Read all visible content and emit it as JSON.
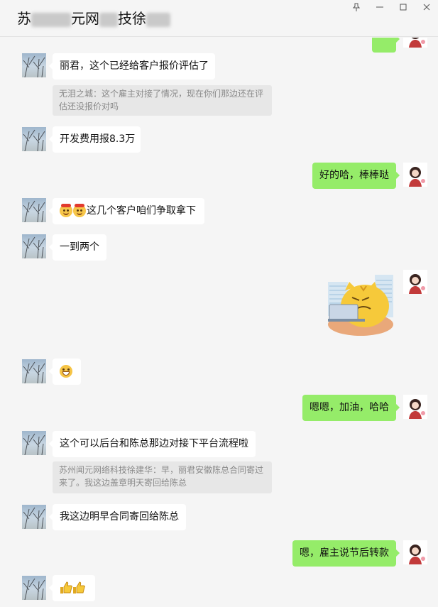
{
  "window": {
    "title_visible_parts": [
      "苏",
      "元网",
      "技徐"
    ],
    "controls": [
      "pin-icon",
      "minimize-icon",
      "maximize-icon",
      "close-icon"
    ]
  },
  "colors": {
    "sent_bubble": "#95ec69",
    "received_bubble": "#ffffff",
    "quote_bg": "#e7e7e7",
    "chat_bg": "#f5f5f5"
  },
  "messages": [
    {
      "side": "left",
      "text": "丽君，这个已经给客户报价评估了"
    },
    {
      "side": "quote",
      "text": "无泪之城：这个雇主对接了情况，现在你们那边还在评估还没报价对吗"
    },
    {
      "side": "left",
      "text": "开发费用报8.3万"
    },
    {
      "side": "right",
      "text": "好的哈，棒棒哒"
    },
    {
      "side": "left",
      "text": "这几个客户咱们争取拿下",
      "emojis": [
        "blush-emoji",
        "blush-emoji"
      ]
    },
    {
      "side": "left",
      "text": "一到两个"
    },
    {
      "side": "right",
      "sticker": "angry-cat-laptop-sticker"
    },
    {
      "side": "left",
      "emojis": [
        "grin-emoji"
      ]
    },
    {
      "side": "right",
      "text": "嗯嗯，加油，哈哈"
    },
    {
      "side": "left",
      "text": "这个可以后台和陈总那边对接下平台流程啦"
    },
    {
      "side": "quote",
      "text": "苏州闻元网络科技徐建华：早，丽君安徽陈总合同寄过来了。我这边盖章明天寄回给陈总"
    },
    {
      "side": "left",
      "text": "我这边明早合同寄回给陈总"
    },
    {
      "side": "right",
      "text": "嗯，雇主说节后转款"
    },
    {
      "side": "left",
      "emojis": [
        "thumbs-up-emoji",
        "thumbs-up-emoji"
      ]
    }
  ]
}
